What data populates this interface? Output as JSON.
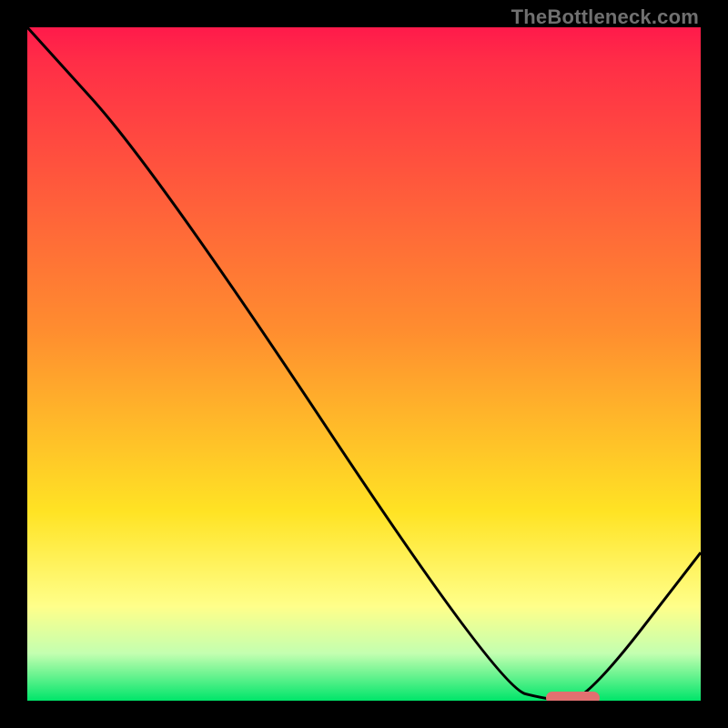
{
  "watermark": "TheBottleneck.com",
  "colors": {
    "top": "#ff1a4b",
    "red": "#ff2d47",
    "orange": "#ff8d2f",
    "yellow": "#ffe324",
    "paleyellow": "#ffff8a",
    "lightgreen": "#c3ffb0",
    "green": "#00e56a",
    "black": "#000000",
    "pill": "#e17070"
  },
  "chart_data": {
    "type": "line",
    "title": "",
    "xlabel": "",
    "ylabel": "",
    "xlim": [
      0,
      100
    ],
    "ylim": [
      0,
      100
    ],
    "grid": false,
    "x": [
      0,
      19,
      70,
      78,
      83,
      100
    ],
    "y": [
      100,
      79,
      2,
      0,
      0,
      22
    ],
    "optimum_marker": {
      "x_start": 77,
      "x_end": 85,
      "y": 0
    },
    "gradient_stops": [
      {
        "pos": 0.0,
        "color": "top"
      },
      {
        "pos": 0.05,
        "color": "red"
      },
      {
        "pos": 0.45,
        "color": "orange"
      },
      {
        "pos": 0.72,
        "color": "yellow"
      },
      {
        "pos": 0.86,
        "color": "paleyellow"
      },
      {
        "pos": 0.93,
        "color": "lightgreen"
      },
      {
        "pos": 1.0,
        "color": "green"
      }
    ]
  }
}
